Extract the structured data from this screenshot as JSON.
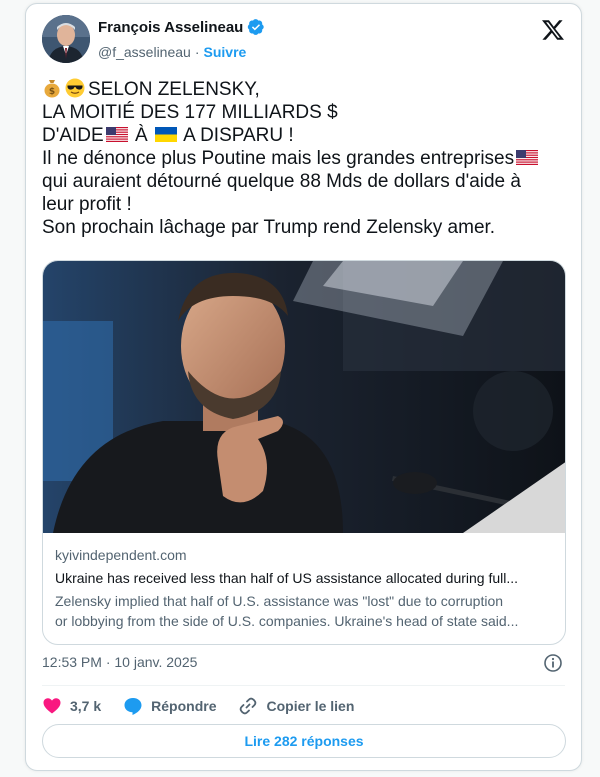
{
  "author": {
    "name": "François Asselineau",
    "handle": "@f_asselineau",
    "separator": "·",
    "follow_label": "Suivre"
  },
  "tweet": {
    "line1": "SELON ZELENSKY,",
    "line2": "LA MOITIÉ DES 177 MILLIARDS $",
    "line3_a": "D'AIDE",
    "line3_b": " À ",
    "line3_c": " A DISPARU !",
    "line4": "Il ne dénonce plus Poutine mais les grandes entreprises",
    "line5": "qui auraient détourné quelque 88 Mds de dollars d'aide à",
    "line6": "leur profit !",
    "line7": "Son prochain lâchage par Trump rend Zelensky amer."
  },
  "link_card": {
    "domain": "kyivindependent.com",
    "title": "Ukraine has received less than half of US assistance allocated during full...",
    "description_line1": "Zelensky implied that half of U.S. assistance was \"lost\" due to corruption",
    "description_line2": "or lobbying from the side of U.S. companies. Ukraine's head of state said..."
  },
  "timestamp": "12:53 PM · 10 janv. 2025",
  "actions": {
    "likes_count": "3,7 k",
    "reply_label": "Répondre",
    "copy_link_label": "Copier le lien"
  },
  "read_replies_label": "Lire 282 réponses",
  "colors": {
    "accent": "#1d9bf0",
    "like": "#f91880",
    "text": "#0f1419",
    "secondary": "#536471",
    "border": "#cfd9de"
  },
  "icons": [
    "verified-badge-icon",
    "x-logo-icon",
    "money-bag-emoji",
    "sunglasses-emoji",
    "us-flag-icon",
    "ukraine-flag-icon",
    "info-icon",
    "heart-icon",
    "reply-bubble-icon",
    "link-icon"
  ]
}
